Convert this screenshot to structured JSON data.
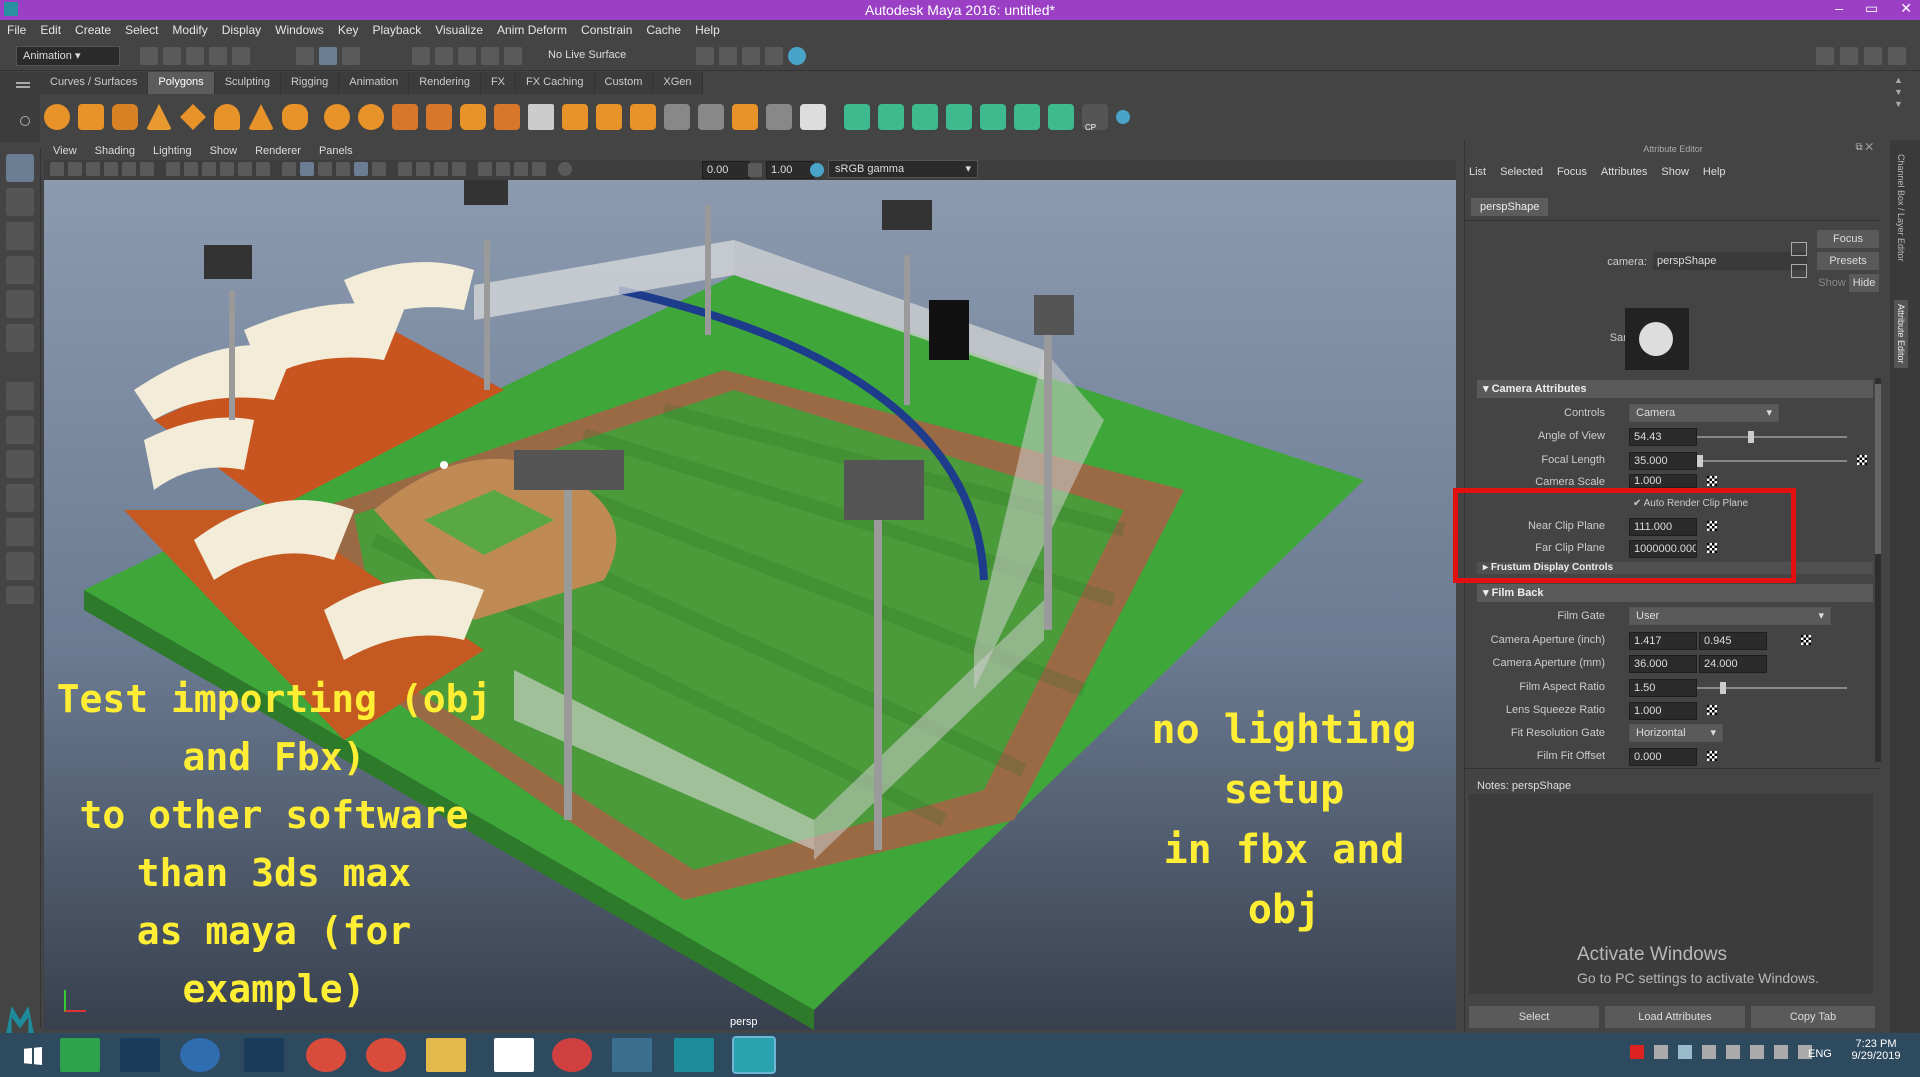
{
  "titlebar": {
    "title": "Autodesk Maya 2016: untitled*",
    "min": "–",
    "max": "▭",
    "close": "✕"
  },
  "menubar": [
    "File",
    "Edit",
    "Create",
    "Select",
    "Modify",
    "Display",
    "Windows",
    "Key",
    "Playback",
    "Visualize",
    "Anim Deform",
    "Constrain",
    "Cache",
    "Help"
  ],
  "statusline": {
    "menuset": "Animation",
    "live_surface": "No Live Surface"
  },
  "shelf": {
    "tabs": [
      "Curves / Surfaces",
      "Polygons",
      "Sculpting",
      "Rigging",
      "Animation",
      "Rendering",
      "FX",
      "FX Caching",
      "Custom",
      "XGen"
    ],
    "active": "Polygons",
    "cp_label": "CP"
  },
  "viewport": {
    "menu": [
      "View",
      "Shading",
      "Lighting",
      "Show",
      "Renderer",
      "Panels"
    ],
    "toolbar": {
      "near": "0.00",
      "far": "1.00",
      "colorspace": "sRGB gamma"
    },
    "camera_label": "persp",
    "caption_left": [
      "Test importing (obj and Fbx)",
      "to other software than 3ds max",
      "as maya (for example)"
    ],
    "caption_right": [
      "no lighting setup",
      "in fbx and obj"
    ]
  },
  "attribute_editor": {
    "header": "Attribute Editor",
    "menu": [
      "List",
      "Selected",
      "Focus",
      "Attributes",
      "Show",
      "Help"
    ],
    "tab": "perspShape",
    "camera_label": "camera:",
    "camera_value": "perspShape",
    "buttons": {
      "focus": "Focus",
      "presets": "Presets",
      "show": "Show",
      "hide": "Hide"
    },
    "sample_label": "Sample",
    "sections": {
      "camera_attributes": "Camera Attributes",
      "frustum": "Frustum Display Controls",
      "film_back": "Film Back"
    },
    "camera_attrs": {
      "controls_label": "Controls",
      "controls_value": "Camera",
      "aov_label": "Angle of View",
      "aov_value": "54.43",
      "aov_slider": 0.34,
      "focal_label": "Focal Length",
      "focal_value": "35.000",
      "focal_slider": 0.0,
      "scale_label": "Camera Scale",
      "scale_value": "1.000",
      "auto_clip_label": "Auto Render Clip Plane",
      "near_label": "Near Clip Plane",
      "near_value": "111.000",
      "far_label": "Far Clip Plane",
      "far_value": "1000000.000"
    },
    "film_back": {
      "gate_label": "Film Gate",
      "gate_value": "User",
      "ap_inch_label": "Camera Aperture (inch)",
      "ap_inch_1": "1.417",
      "ap_inch_2": "0.945",
      "ap_mm_label": "Camera Aperture (mm)",
      "ap_mm_1": "36.000",
      "ap_mm_2": "24.000",
      "aspect_label": "Film Aspect Ratio",
      "aspect_value": "1.50",
      "aspect_slider": 0.15,
      "squeeze_label": "Lens Squeeze Ratio",
      "squeeze_value": "1.000",
      "fitgate_label": "Fit Resolution Gate",
      "fitgate_value": "Horizontal",
      "offset_label": "Film Fit Offset",
      "offset_value": "0.000"
    },
    "notes_label": "Notes:  perspShape",
    "watermark_title": "Activate Windows",
    "watermark_sub": "Go to PC settings to activate Windows.",
    "bottom_buttons": [
      "Select",
      "Load Attributes",
      "Copy Tab"
    ],
    "side_tabs": [
      "Channel Box / Layer Editor",
      "Attribute Editor"
    ]
  },
  "taskbar": {
    "time": "7:23 PM",
    "date": "9/29/2019",
    "lang": "ENG"
  }
}
